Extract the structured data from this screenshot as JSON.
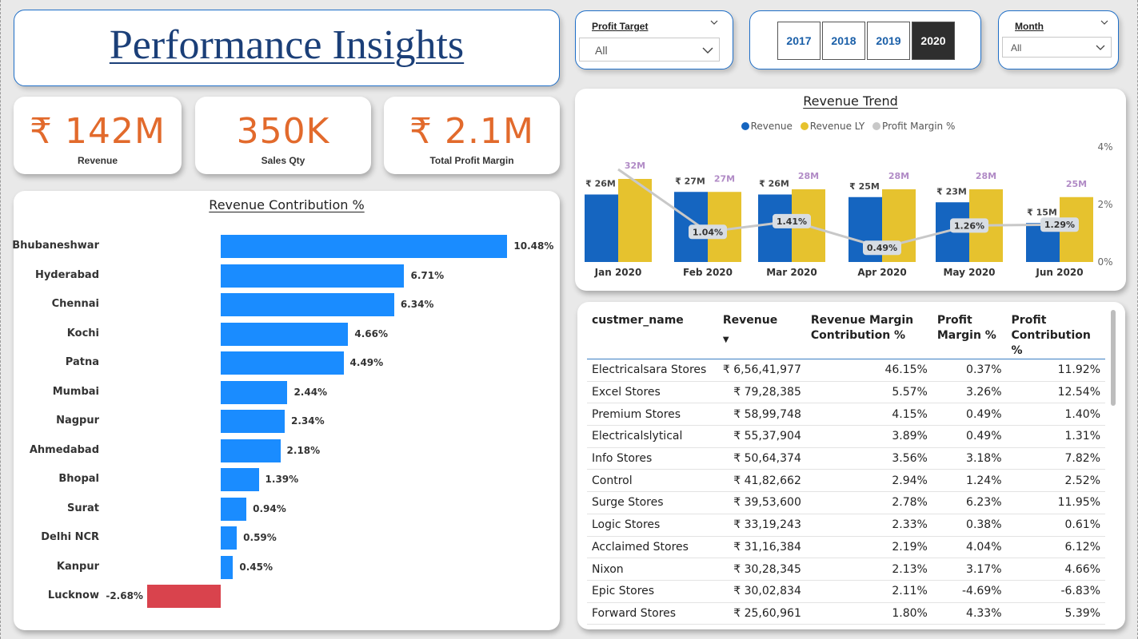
{
  "title": "Performance Insights",
  "slicers": {
    "profit_target": {
      "label": "Profit Target",
      "value": "All"
    },
    "years": [
      "2017",
      "2018",
      "2019",
      "2020"
    ],
    "selected_year": "2020",
    "month": {
      "label": "Month",
      "value": "All"
    }
  },
  "kpis": [
    {
      "value": "₹ 142M",
      "label": "Revenue"
    },
    {
      "value": "350K",
      "label": "Sales Qty"
    },
    {
      "value": "₹ 2.1M",
      "label": "Total Profit Margin"
    }
  ],
  "chart_data": [
    {
      "type": "bar",
      "title": "Revenue Contribution %",
      "categories": [
        "Bhubaneshwar",
        "Hyderabad",
        "Chennai",
        "Kochi",
        "Patna",
        "Mumbai",
        "Nagpur",
        "Ahmedabad",
        "Bhopal",
        "Surat",
        "Delhi NCR",
        "Kanpur",
        "Lucknow"
      ],
      "values": [
        10.48,
        6.71,
        6.34,
        4.66,
        4.49,
        2.44,
        2.34,
        2.18,
        1.39,
        0.94,
        0.59,
        0.45,
        -2.68
      ],
      "value_labels": [
        "10.48%",
        "6.71%",
        "6.34%",
        "4.66%",
        "4.49%",
        "2.44%",
        "2.34%",
        "2.18%",
        "1.39%",
        "0.94%",
        "0.59%",
        "0.45%",
        "-2.68%"
      ],
      "colors": {
        "positive": "#1a8cff",
        "negative": "#d9434d"
      }
    },
    {
      "type": "bar",
      "title": "Revenue Trend",
      "categories": [
        "Jan 2020",
        "Feb 2020",
        "Mar 2020",
        "Apr 2020",
        "May 2020",
        "Jun 2020"
      ],
      "series": [
        {
          "name": "Revenue",
          "values": [
            26,
            27,
            26,
            25,
            23,
            15
          ],
          "labels": [
            "₹ 26M",
            "₹ 27M",
            "₹ 26M",
            "₹ 25M",
            "₹ 23M",
            "₹ 15M"
          ],
          "color": "#1565c0"
        },
        {
          "name": "Revenue LY",
          "values": [
            32,
            27,
            28,
            28,
            28,
            25
          ],
          "labels": [
            "32M",
            "27M",
            "28M",
            "28M",
            "28M",
            "25M"
          ],
          "color": "#e6c22e"
        },
        {
          "name": "Profit Margin %",
          "type": "line",
          "axis": "right",
          "values": [
            3.2,
            1.04,
            1.41,
            0.49,
            1.26,
            1.29
          ],
          "labels": [
            "",
            "1.04%",
            "1.41%",
            "0.49%",
            "1.26%",
            "1.29%"
          ],
          "color": "#c8c8c8"
        }
      ],
      "ylim": [
        0,
        40
      ],
      "y2_ticks": [
        "4%",
        "2%",
        "0%"
      ],
      "y2lim": [
        0,
        4
      ],
      "legend": "top-center"
    }
  ],
  "table": {
    "headers": [
      "custmer_name",
      "Revenue",
      "Revenue Margin Contribution %",
      "Profit Margin %",
      "Profit Contribution %"
    ],
    "header_lines": [
      [
        "custmer_name"
      ],
      [
        "Revenue"
      ],
      [
        "Revenue Margin",
        "Contribution %"
      ],
      [
        "Profit",
        "Margin %"
      ],
      [
        "Profit",
        "Contribution %"
      ]
    ],
    "rows": [
      [
        "Electricalsara Stores",
        "₹ 6,56,41,977",
        "46.15%",
        "0.37%",
        "11.92%"
      ],
      [
        "Excel Stores",
        "₹ 79,28,385",
        "5.57%",
        "3.26%",
        "12.54%"
      ],
      [
        "Premium Stores",
        "₹ 58,99,748",
        "4.15%",
        "0.49%",
        "1.40%"
      ],
      [
        "Electricalslytical",
        "₹ 55,37,904",
        "3.89%",
        "0.49%",
        "1.31%"
      ],
      [
        "Info Stores",
        "₹ 50,64,374",
        "3.56%",
        "3.18%",
        "7.82%"
      ],
      [
        "Control",
        "₹ 41,82,662",
        "2.94%",
        "1.24%",
        "2.52%"
      ],
      [
        "Surge Stores",
        "₹ 39,53,600",
        "2.78%",
        "6.23%",
        "11.95%"
      ],
      [
        "Logic Stores",
        "₹ 33,19,243",
        "2.33%",
        "0.38%",
        "0.61%"
      ],
      [
        "Acclaimed Stores",
        "₹ 31,16,384",
        "2.19%",
        "4.04%",
        "6.12%"
      ],
      [
        "Nixon",
        "₹ 30,28,345",
        "2.13%",
        "3.17%",
        "4.66%"
      ],
      [
        "Epic Stores",
        "₹ 30,02,834",
        "2.11%",
        "-4.69%",
        "-6.83%"
      ],
      [
        "Forward Stores",
        "₹ 25,60,961",
        "1.80%",
        "4.33%",
        "5.39%"
      ]
    ]
  }
}
